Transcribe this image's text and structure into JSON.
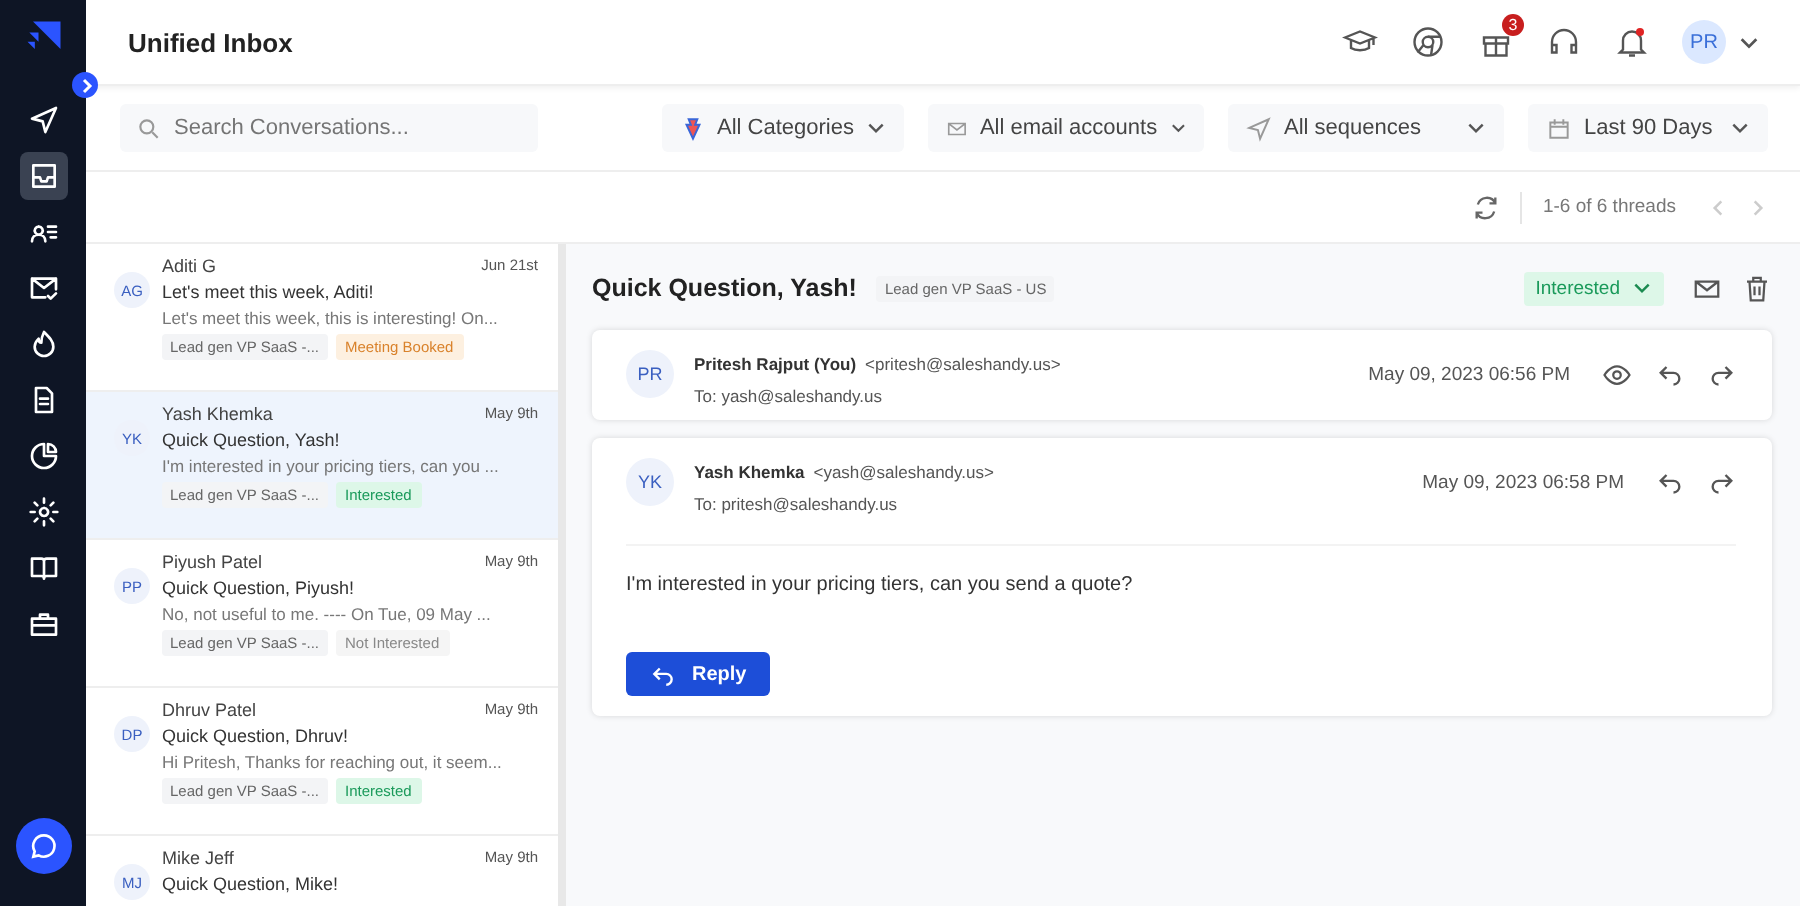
{
  "sidebar": {
    "items": [
      {
        "kind": "send",
        "selected": false
      },
      {
        "kind": "inbox",
        "selected": true
      },
      {
        "kind": "contacts",
        "selected": false
      },
      {
        "kind": "mail-check",
        "selected": false
      },
      {
        "kind": "fire",
        "selected": false
      },
      {
        "kind": "document",
        "selected": false
      },
      {
        "kind": "pie",
        "selected": false
      },
      {
        "kind": "gear",
        "selected": false
      },
      {
        "kind": "book",
        "selected": false
      },
      {
        "kind": "briefcase",
        "selected": false
      }
    ]
  },
  "header": {
    "title": "Unified Inbox",
    "gift_badge": "3",
    "bell_alert": true,
    "avatar": "PR"
  },
  "filters": {
    "search": {
      "placeholder": "Search Conversations..."
    },
    "dropdowns": [
      {
        "kind": "category",
        "label": "All Categories"
      },
      {
        "kind": "mail",
        "label": "All email accounts"
      },
      {
        "kind": "send",
        "label": "All sequences"
      },
      {
        "kind": "calendar",
        "label": "Last 90 Days"
      }
    ]
  },
  "pager": "1-6 of 6 threads",
  "threads": [
    {
      "initials": "AG",
      "name": "Aditi G",
      "date": "Jun 21st",
      "subject": "Let's meet this week, Aditi!",
      "preview": "Let's meet this week, this is interesting! On...",
      "sequence": "Lead gen VP SaaS -...",
      "tag": {
        "kind": "meeting",
        "label": "Meeting Booked"
      },
      "selected": false
    },
    {
      "initials": "YK",
      "name": "Yash Khemka",
      "date": "May 9th",
      "subject": "Quick Question, Yash!",
      "preview": "I'm interested in your pricing tiers, can you ...",
      "sequence": "Lead gen VP SaaS -...",
      "tag": {
        "kind": "interested",
        "label": "Interested"
      },
      "selected": true
    },
    {
      "initials": "PP",
      "name": "Piyush Patel",
      "date": "May 9th",
      "subject": "Quick Question, Piyush!",
      "preview": "No, not useful to me. ---- On Tue, 09 May ...",
      "sequence": "Lead gen VP SaaS -...",
      "tag": {
        "kind": "not-interested",
        "label": "Not Interested"
      },
      "selected": false
    },
    {
      "initials": "DP",
      "name": "Dhruv Patel",
      "date": "May 9th",
      "subject": "Quick Question, Dhruv!",
      "preview": "Hi Pritesh, Thanks for reaching out, it seem...",
      "sequence": "Lead gen VP SaaS -...",
      "tag": {
        "kind": "interested",
        "label": "Interested"
      },
      "selected": false
    },
    {
      "initials": "MJ",
      "name": "Mike Jeff",
      "date": "May 9th",
      "subject": "Quick Question, Mike!",
      "selected": false
    }
  ],
  "detail": {
    "title": "Quick Question, Yash!",
    "sequence": "Lead gen VP SaaS - US",
    "status": {
      "kind": "interested",
      "label": "Interested"
    },
    "messages": [
      {
        "initials": "PR",
        "name": "Pritesh Rajput (You)",
        "email": "<pritesh@saleshandy.us>",
        "to": "To: yash@saleshandy.us",
        "time": "May 09, 2023 06:56 PM",
        "viewed": true
      },
      {
        "initials": "YK",
        "name": "Yash Khemka",
        "email": "<yash@saleshandy.us>",
        "to": "To: pritesh@saleshandy.us",
        "time": "May 09, 2023 06:58 PM",
        "viewed": false,
        "body": "I'm interested in your pricing tiers, can you send a quote?",
        "reply": "Reply"
      }
    ]
  }
}
